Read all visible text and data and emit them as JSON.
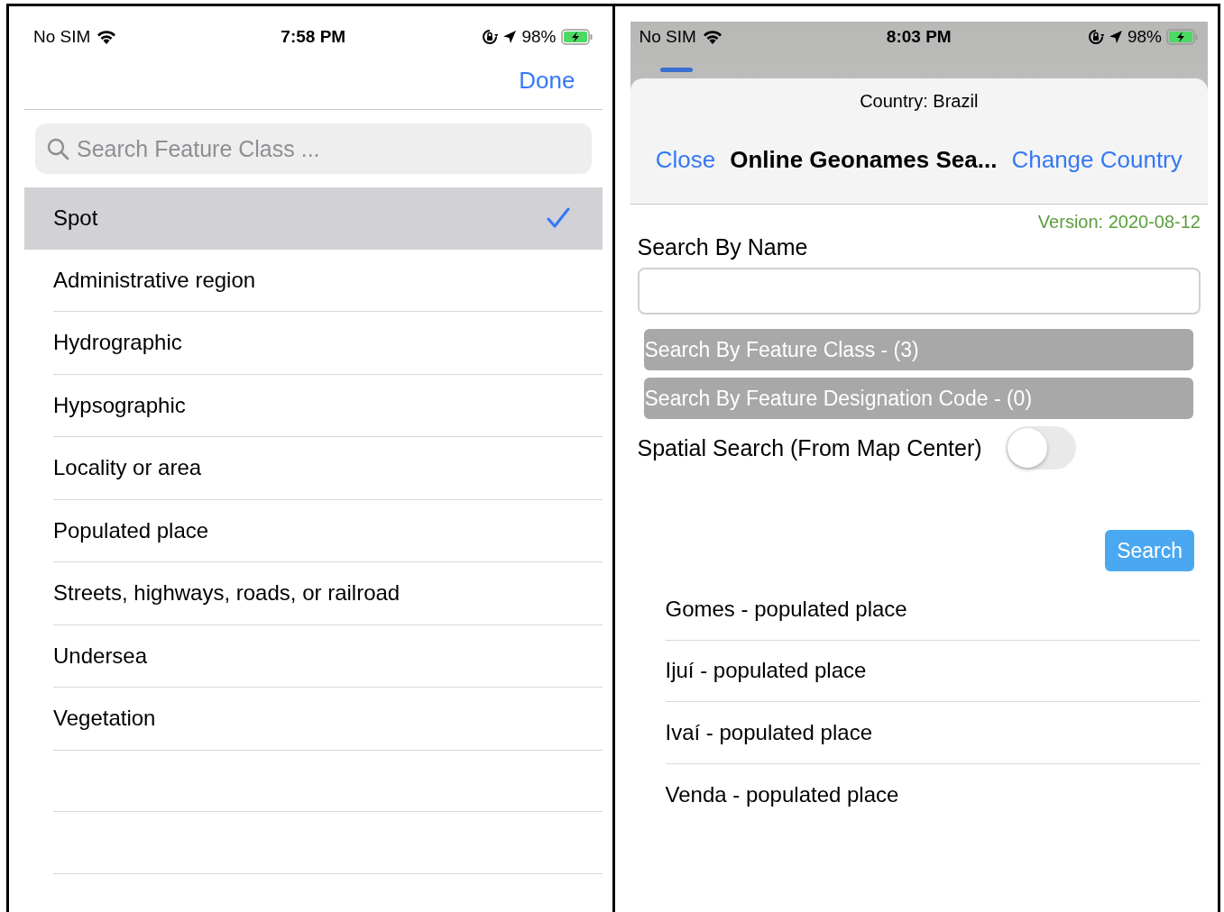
{
  "left": {
    "status_bar": {
      "carrier": "No SIM",
      "time": "7:58 PM",
      "battery": "98%"
    },
    "done_button": "Done",
    "search": {
      "placeholder": "Search Feature Class ..."
    },
    "feature_classes": [
      {
        "label": "Spot",
        "selected": true
      },
      {
        "label": "Administrative region",
        "selected": false
      },
      {
        "label": "Hydrographic",
        "selected": false
      },
      {
        "label": "Hypsographic",
        "selected": false
      },
      {
        "label": "Locality or area",
        "selected": false
      },
      {
        "label": "Populated place",
        "selected": false
      },
      {
        "label": "Streets, highways, roads, or railroad",
        "selected": false
      },
      {
        "label": "Undersea",
        "selected": false
      },
      {
        "label": "Vegetation",
        "selected": false
      }
    ]
  },
  "right": {
    "status_bar": {
      "carrier": "No SIM",
      "time": "8:03 PM",
      "battery": "98%"
    },
    "sheet": {
      "subtitle": "Country: Brazil",
      "close": "Close",
      "title": "Online Geonames Sea...",
      "change_country": "Change Country"
    },
    "version": "Version: 2020-08-12",
    "name_label": "Search By Name",
    "filters": [
      "Search By Feature Class - (3)",
      "Search By Feature Designation Code - (0)"
    ],
    "spatial": {
      "label": "Spatial Search (From Map Center)",
      "on": false
    },
    "search_button": "Search",
    "results": [
      "Gomes - populated place",
      "Ijuí - populated place",
      "Ivaí - populated place",
      "Venda - populated place"
    ]
  }
}
